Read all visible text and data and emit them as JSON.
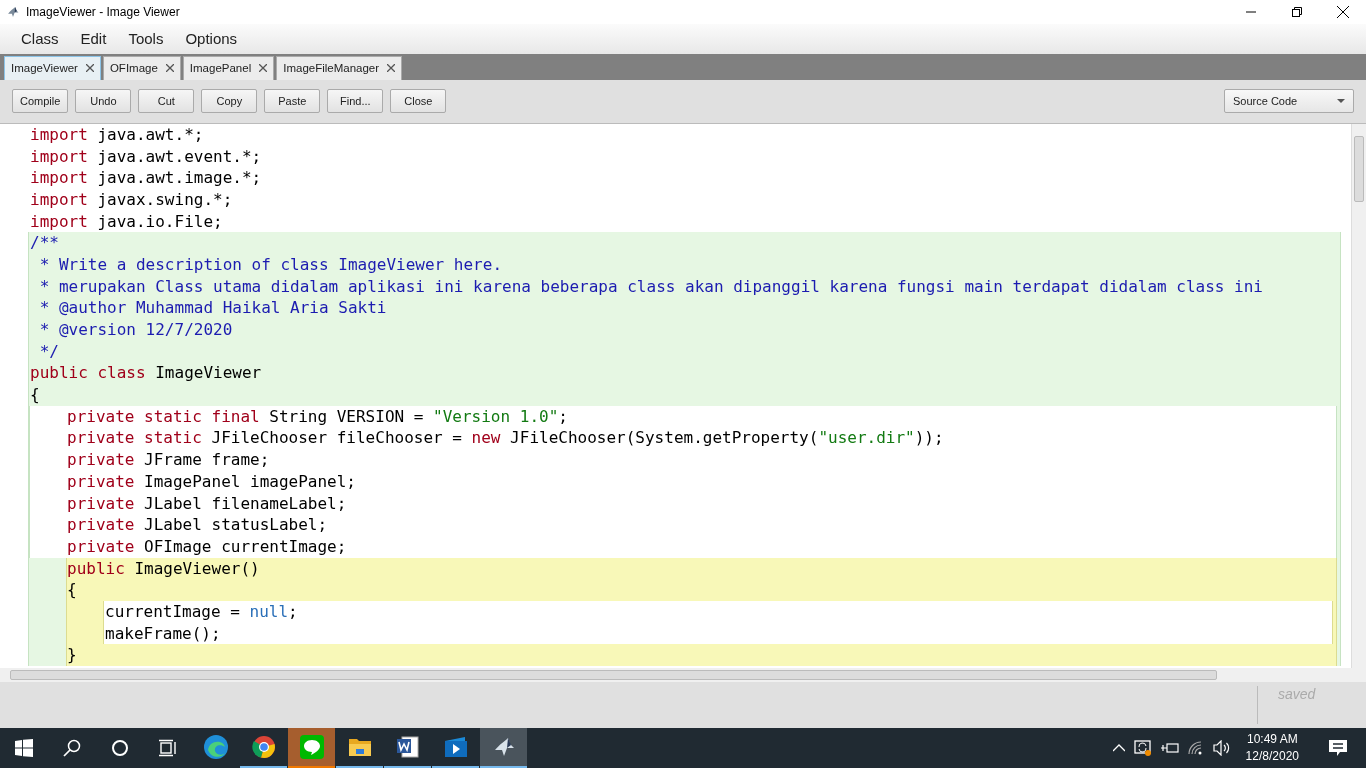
{
  "window": {
    "title": "ImageViewer - Image Viewer"
  },
  "menu": [
    "Class",
    "Edit",
    "Tools",
    "Options"
  ],
  "tabs": [
    {
      "label": "ImageViewer",
      "selected": true
    },
    {
      "label": "OFImage",
      "selected": false
    },
    {
      "label": "ImagePanel",
      "selected": false
    },
    {
      "label": "ImageFileManager",
      "selected": false
    }
  ],
  "toolbar": {
    "buttons": [
      "Compile",
      "Undo",
      "Cut",
      "Copy",
      "Paste",
      "Find...",
      "Close"
    ],
    "view_select": "Source Code"
  },
  "code": [
    {
      "kind": "top",
      "parts": [
        {
          "kind": "keyword",
          "text": "import"
        },
        {
          "kind": "plain",
          "text": " java.awt.*;"
        }
      ]
    },
    {
      "kind": "top",
      "parts": [
        {
          "kind": "keyword",
          "text": "import"
        },
        {
          "kind": "plain",
          "text": " java.awt.event.*;"
        }
      ]
    },
    {
      "kind": "top",
      "parts": [
        {
          "kind": "keyword",
          "text": "import"
        },
        {
          "kind": "plain",
          "text": " java.awt.image.*;"
        }
      ]
    },
    {
      "kind": "top",
      "parts": [
        {
          "kind": "keyword",
          "text": "import"
        },
        {
          "kind": "plain",
          "text": " javax.swing.*;"
        }
      ]
    },
    {
      "kind": "top",
      "parts": [
        {
          "kind": "keyword",
          "text": "import"
        },
        {
          "kind": "plain",
          "text": " java.io.File;"
        }
      ]
    },
    {
      "kind": "class",
      "parts": [
        {
          "kind": "comment",
          "text": "/**"
        }
      ]
    },
    {
      "kind": "class",
      "parts": [
        {
          "kind": "comment",
          "text": " * Write a description of class ImageViewer here."
        }
      ]
    },
    {
      "kind": "class",
      "parts": [
        {
          "kind": "comment",
          "text": " * merupakan Class utama didalam aplikasi ini karena beberapa class akan dipanggil karena fungsi main terdapat didalam class ini"
        }
      ]
    },
    {
      "kind": "class",
      "parts": [
        {
          "kind": "comment",
          "text": " * @author Muhammad Haikal Aria Sakti"
        }
      ]
    },
    {
      "kind": "class",
      "parts": [
        {
          "kind": "comment",
          "text": " * @version 12/7/2020"
        }
      ]
    },
    {
      "kind": "class",
      "parts": [
        {
          "kind": "comment",
          "text": " */"
        }
      ]
    },
    {
      "kind": "class",
      "parts": [
        {
          "kind": "keyword",
          "text": "public class"
        },
        {
          "kind": "plain",
          "text": " ImageViewer"
        }
      ]
    },
    {
      "kind": "class",
      "parts": [
        {
          "kind": "plain",
          "text": "{"
        }
      ]
    },
    {
      "kind": "class-body",
      "parts": [
        {
          "kind": "keyword",
          "text": "private static final"
        },
        {
          "kind": "plain",
          "text": " String VERSION = "
        },
        {
          "kind": "string",
          "text": "\"Version 1.0\""
        },
        {
          "kind": "plain",
          "text": ";"
        }
      ]
    },
    {
      "kind": "class-body",
      "parts": [
        {
          "kind": "keyword",
          "text": "private static"
        },
        {
          "kind": "plain",
          "text": " JFileChooser fileChooser = "
        },
        {
          "kind": "keyword",
          "text": "new"
        },
        {
          "kind": "plain",
          "text": " JFileChooser(System.getProperty("
        },
        {
          "kind": "string",
          "text": "\"user.dir\""
        },
        {
          "kind": "plain",
          "text": "));"
        }
      ]
    },
    {
      "kind": "class-body",
      "parts": [
        {
          "kind": "keyword",
          "text": "private"
        },
        {
          "kind": "plain",
          "text": " JFrame frame;"
        }
      ]
    },
    {
      "kind": "class-body",
      "parts": [
        {
          "kind": "keyword",
          "text": "private"
        },
        {
          "kind": "plain",
          "text": " ImagePanel imagePanel;"
        }
      ]
    },
    {
      "kind": "class-body",
      "parts": [
        {
          "kind": "keyword",
          "text": "private"
        },
        {
          "kind": "plain",
          "text": " JLabel filenameLabel;"
        }
      ]
    },
    {
      "kind": "class-body",
      "parts": [
        {
          "kind": "keyword",
          "text": "private"
        },
        {
          "kind": "plain",
          "text": " JLabel statusLabel;"
        }
      ]
    },
    {
      "kind": "class-body",
      "parts": [
        {
          "kind": "keyword",
          "text": "private"
        },
        {
          "kind": "plain",
          "text": " OFImage currentImage;"
        }
      ]
    },
    {
      "kind": "method",
      "parts": [
        {
          "kind": "keyword",
          "text": "public"
        },
        {
          "kind": "plain",
          "text": " ImageViewer()"
        }
      ]
    },
    {
      "kind": "method",
      "parts": [
        {
          "kind": "plain",
          "text": "{"
        }
      ]
    },
    {
      "kind": "method-body",
      "parts": [
        {
          "kind": "plain",
          "text": "currentImage = "
        },
        {
          "kind": "literal",
          "text": "null"
        },
        {
          "kind": "plain",
          "text": ";"
        }
      ]
    },
    {
      "kind": "method-body",
      "parts": [
        {
          "kind": "plain",
          "text": "makeFrame();"
        }
      ]
    },
    {
      "kind": "method",
      "parts": [
        {
          "kind": "plain",
          "text": "}"
        }
      ]
    }
  ],
  "status": "saved",
  "taskbar": {
    "apps": [
      {
        "kind": "edge",
        "running": false,
        "selected": false,
        "flashing": false
      },
      {
        "kind": "chrome",
        "running": true,
        "selected": false,
        "flashing": false
      },
      {
        "kind": "line",
        "running": true,
        "selected": false,
        "flashing": true
      },
      {
        "kind": "folder",
        "running": true,
        "selected": false,
        "flashing": false
      },
      {
        "kind": "word",
        "running": true,
        "selected": false,
        "flashing": false
      },
      {
        "kind": "media",
        "running": true,
        "selected": false,
        "flashing": false
      },
      {
        "kind": "bird",
        "running": true,
        "selected": true,
        "flashing": false
      }
    ],
    "time": "10:49 AM",
    "date": "12/8/2020"
  }
}
